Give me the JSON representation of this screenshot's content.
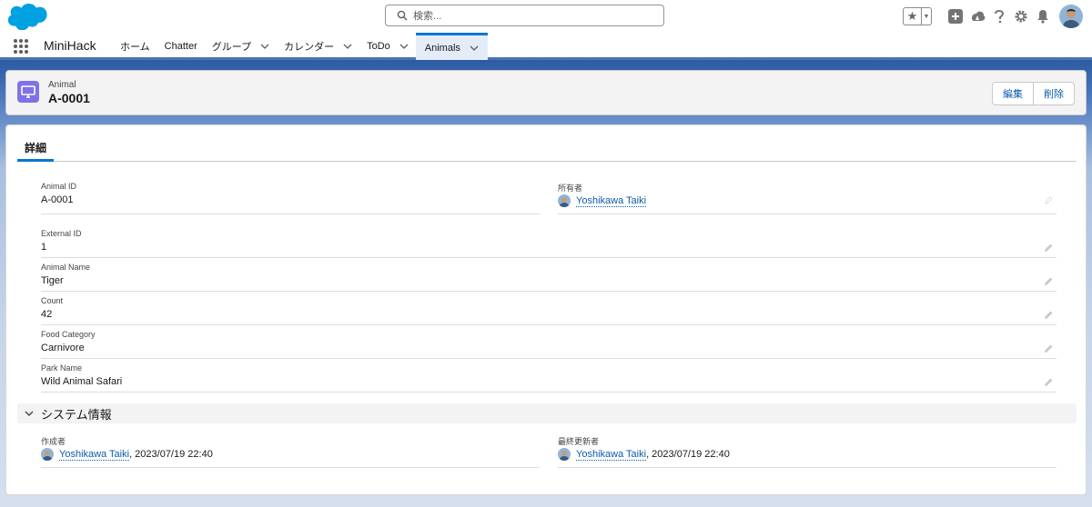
{
  "header": {
    "search_placeholder": "検索..."
  },
  "nav": {
    "app_name": "MiniHack",
    "items": [
      {
        "label": "ホーム",
        "has_menu": false,
        "active": false
      },
      {
        "label": "Chatter",
        "has_menu": false,
        "active": false
      },
      {
        "label": "グループ",
        "has_menu": true,
        "active": false
      },
      {
        "label": "カレンダー",
        "has_menu": true,
        "active": false
      },
      {
        "label": "ToDo",
        "has_menu": true,
        "active": false
      },
      {
        "label": "Animals",
        "has_menu": true,
        "active": true
      }
    ]
  },
  "record": {
    "object_label": "Animal",
    "title": "A-0001",
    "edit_label": "編集",
    "delete_label": "削除"
  },
  "tab": {
    "details_label": "詳細"
  },
  "fields": {
    "animal_id": {
      "label": "Animal ID",
      "value": "A-0001"
    },
    "owner": {
      "label": "所有者",
      "value": "Yoshikawa Taiki"
    },
    "external_id": {
      "label": "External ID",
      "value": "1"
    },
    "animal_name": {
      "label": "Animal Name",
      "value": "Tiger"
    },
    "count": {
      "label": "Count",
      "value": "42"
    },
    "food_category": {
      "label": "Food Category",
      "value": "Carnivore"
    },
    "park_name": {
      "label": "Park Name",
      "value": "Wild Animal Safari"
    }
  },
  "system_section": {
    "title": "システム情報",
    "created_by": {
      "label": "作成者",
      "user": "Yoshikawa Taiki",
      "date": ", 2023/07/19 22:40"
    },
    "last_modified_by": {
      "label": "最終更新者",
      "user": "Yoshikawa Taiki",
      "date": ", 2023/07/19 22:40"
    }
  },
  "colors": {
    "brand": "#0176d3",
    "link": "#0b5cab",
    "object_icon": "#7f72e6",
    "nav_active_bg": "#e3ecf7"
  },
  "icons": [
    "salesforce-cloud-icon",
    "search-icon",
    "star-icon",
    "add-icon",
    "trailhead-icon",
    "help-icon",
    "gear-icon",
    "bell-icon",
    "app-launcher-icon",
    "object-icon",
    "pencil-icon",
    "chevron-down-icon"
  ]
}
